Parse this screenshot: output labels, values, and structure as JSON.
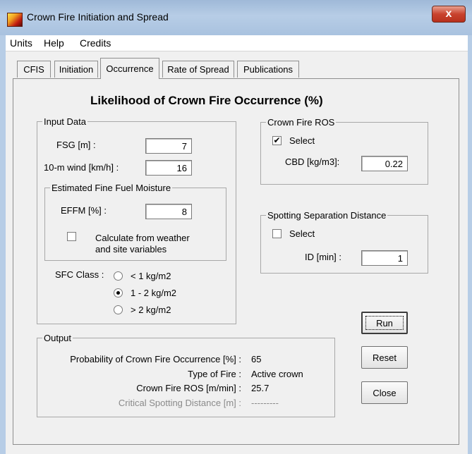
{
  "window": {
    "title": "Crown Fire Initiation and Spread",
    "close_glyph": "x"
  },
  "menu": [
    "Units",
    "Help",
    "Credits"
  ],
  "tabs": [
    "CFIS",
    "Initiation",
    "Occurrence",
    "Rate of Spread",
    "Publications"
  ],
  "active_tab": "Occurrence",
  "heading": "Likelihood of Crown Fire Occurrence (%)",
  "input_data": {
    "legend": "Input Data",
    "fsg_label": "FSG [m] :",
    "fsg_value": "7",
    "wind_label": "10-m wind  [km/h] :",
    "wind_value": "16",
    "effm": {
      "legend": "Estimated Fine Fuel Moisture",
      "label": "EFFM [%] :",
      "value": "8",
      "calc_label_line1": "Calculate from weather",
      "calc_label_line2": "and site variables",
      "calc_checked": false
    },
    "sfc": {
      "label": "SFC Class :",
      "options": [
        "< 1 kg/m2",
        "1 - 2 kg/m2",
        "> 2 kg/m2"
      ],
      "selected": "1 - 2 kg/m2"
    }
  },
  "crown_fire_ros": {
    "legend": "Crown Fire ROS",
    "select_label": "Select",
    "select_checked": true,
    "check_glyph": "✔",
    "cbd_label": "CBD [kg/m3]:",
    "cbd_value": "0.22"
  },
  "spotting": {
    "legend": "Spotting Separation Distance",
    "select_label": "Select",
    "select_checked": false,
    "id_label": "ID [min] :",
    "id_value": "1"
  },
  "output": {
    "legend": "Output",
    "rows": [
      {
        "label": "Probability of Crown Fire Occurrence [%] :",
        "value": "65"
      },
      {
        "label": "Type of Fire :",
        "value": "Active crown"
      },
      {
        "label": "Crown Fire ROS [m/min] :",
        "value": "25.7"
      },
      {
        "label": "Critical Spotting Distance [m] :",
        "value": "---------"
      }
    ]
  },
  "buttons": {
    "run": "Run",
    "reset": "Reset",
    "close": "Close"
  }
}
